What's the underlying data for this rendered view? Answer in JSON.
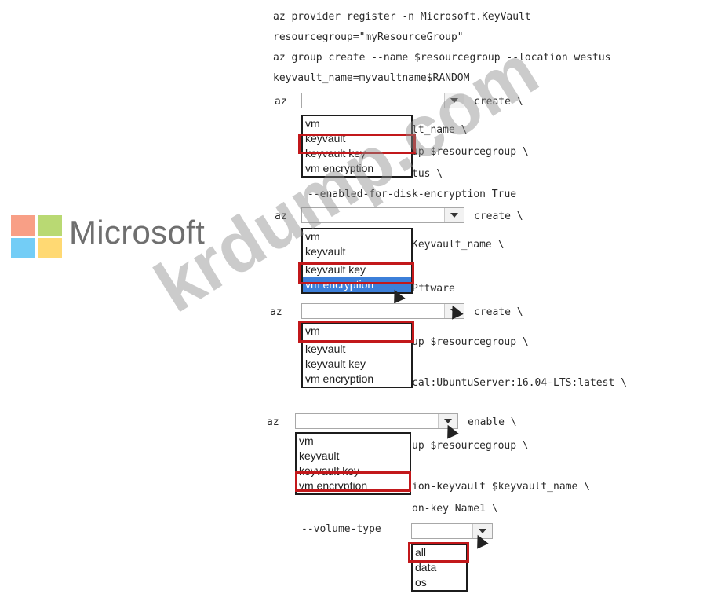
{
  "logo": {
    "text": "Microsoft",
    "colors": [
      "#f25022",
      "#7fba00",
      "#00a4ef",
      "#ffb900"
    ]
  },
  "watermark": "krdump.com",
  "code": {
    "line1": "az provider register -n Microsoft.KeyVault",
    "line2": "resourcegroup=\"myResourceGroup\"",
    "line3": "az group create --name $resourcegroup --location westus",
    "line4": "keyvault_name=myvaultname$RANDOM",
    "b1_az": "az",
    "b1_after": "create \\",
    "b1_l2": "lt_name \\",
    "b1_l3": "up $resourcegroup \\",
    "b1_l4": "tus \\",
    "b1_l5": "--enabled-for-disk-encryption True",
    "b2_az": "az",
    "b2_after": "create \\",
    "b2_l2": "Keyvault_name \\",
    "b2_l3": "Pftware",
    "b3_az": "az",
    "b3_after": "create \\",
    "b3_l2": "up $resourcegroup \\",
    "b3_l3": "cal:UbuntuServer:16.04-LTS:latest \\",
    "b4_az": "az",
    "b4_after": "enable \\",
    "b4_l2": "up $resourcegroup \\",
    "b4_l3": "ion-keyvault $keyvault_name \\",
    "b4_l4": "on-key Name1 \\",
    "b4_l5": "--volume-type"
  },
  "dropdown1": {
    "options": [
      "vm",
      "keyvault",
      "keyvault key",
      "vm encryption"
    ],
    "selected": "keyvault"
  },
  "dropdown2": {
    "options": [
      "vm",
      "keyvault",
      "keyvault key",
      "vm encryption"
    ],
    "selected": "keyvault key"
  },
  "dropdown3": {
    "options": [
      "vm",
      "keyvault",
      "keyvault key",
      "vm encryption"
    ],
    "selected": "vm"
  },
  "dropdown4": {
    "options": [
      "vm",
      "keyvault",
      "keyvault key",
      "vm encryption"
    ],
    "selected": "keyvault key"
  },
  "dropdown5": {
    "options": [
      "all",
      "data",
      "os"
    ],
    "selected": "all"
  },
  "highlight_color": "#c2181b"
}
